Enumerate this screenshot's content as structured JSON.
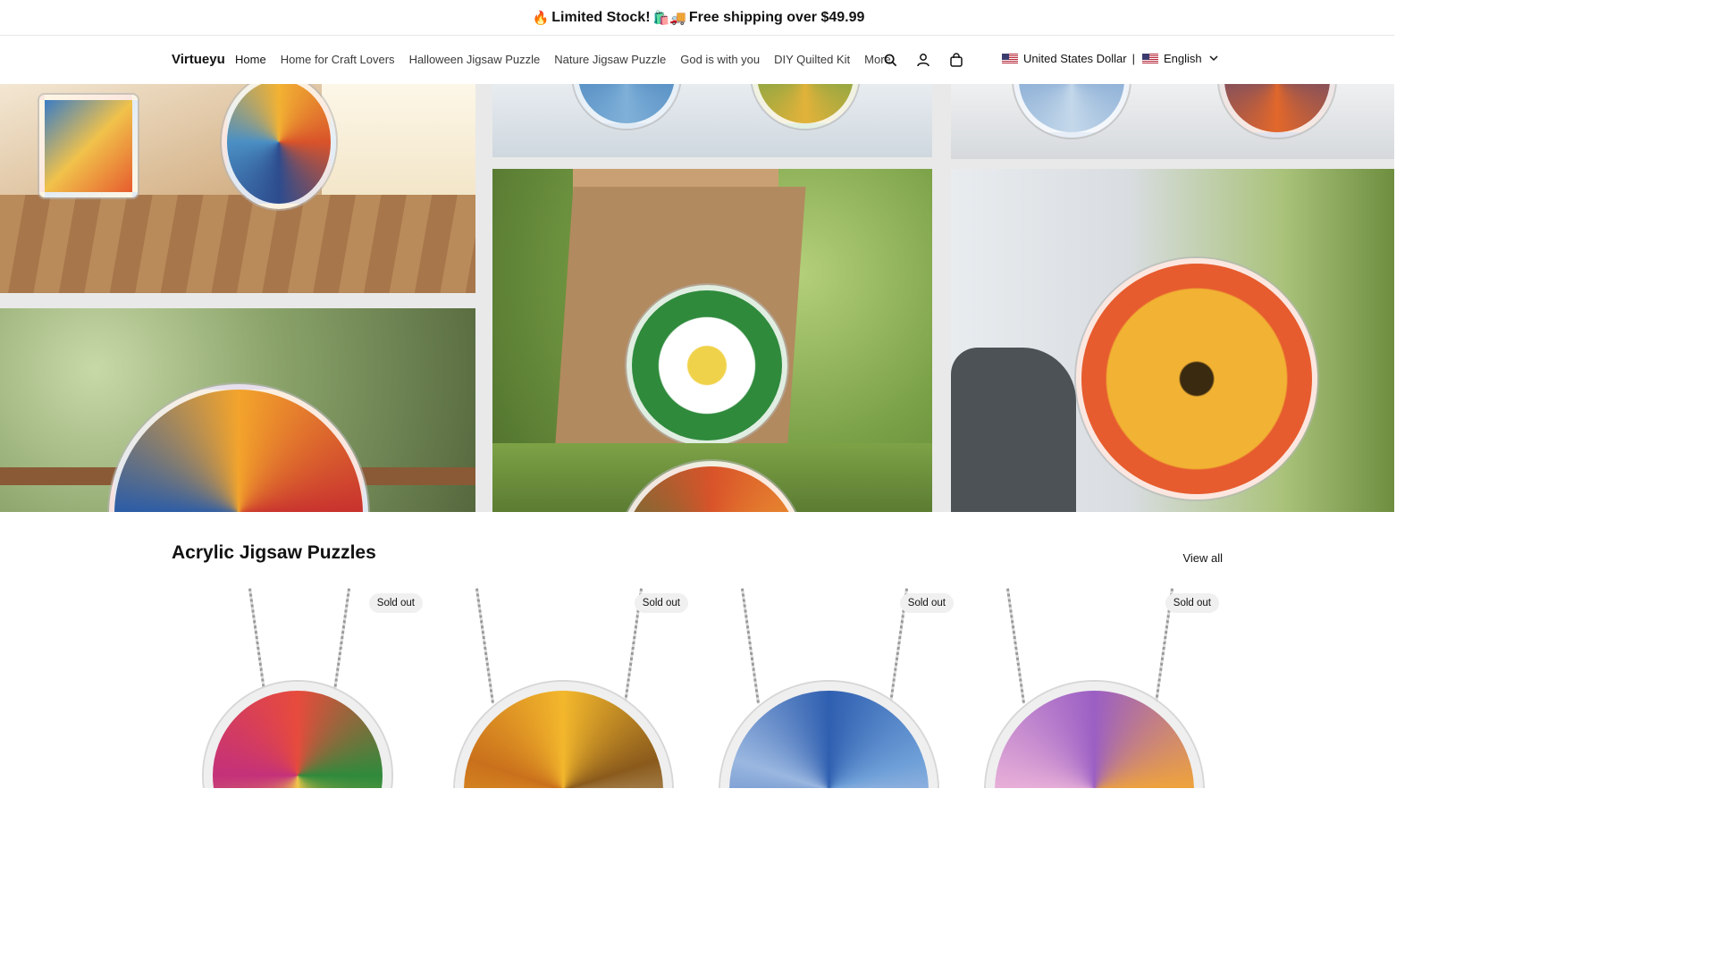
{
  "announcement": {
    "prefix_emoji": "🔥",
    "text_1": "Limited Stock!",
    "mid_emoji": "🛍️🚚",
    "text_2": "Free shipping over $49.99"
  },
  "header": {
    "logo": "Virtueyu",
    "nav": [
      {
        "label": "Home",
        "active": true
      },
      {
        "label": "Home for Craft Lovers"
      },
      {
        "label": "Halloween Jigsaw Puzzle"
      },
      {
        "label": "Nature Jigsaw Puzzle"
      },
      {
        "label": "God is with you"
      },
      {
        "label": "DIY Quilted Kit"
      },
      {
        "label": "More"
      }
    ],
    "icons": [
      "search-icon",
      "account-icon",
      "cart-icon"
    ],
    "currency": "United States Dollar",
    "separator": "|",
    "language": "English"
  },
  "section": {
    "title": "Acrylic Jigsaw Puzzles",
    "view_all": "View all"
  },
  "products": [
    {
      "badge": "Sold out",
      "colors": [
        "#e74b3c",
        "#2f8a3c",
        "#f2c84b"
      ]
    },
    {
      "badge": "Sold out",
      "colors": [
        "#f3b72c",
        "#8a5a1c",
        "#e8e2c4"
      ]
    },
    {
      "badge": "Sold out",
      "colors": [
        "#2f5fb0",
        "#6fa0d8",
        "#e8e1f0"
      ]
    },
    {
      "badge": "Sold out",
      "colors": [
        "#9b5fc4",
        "#f0a43a",
        "#2f7a8c"
      ]
    }
  ]
}
